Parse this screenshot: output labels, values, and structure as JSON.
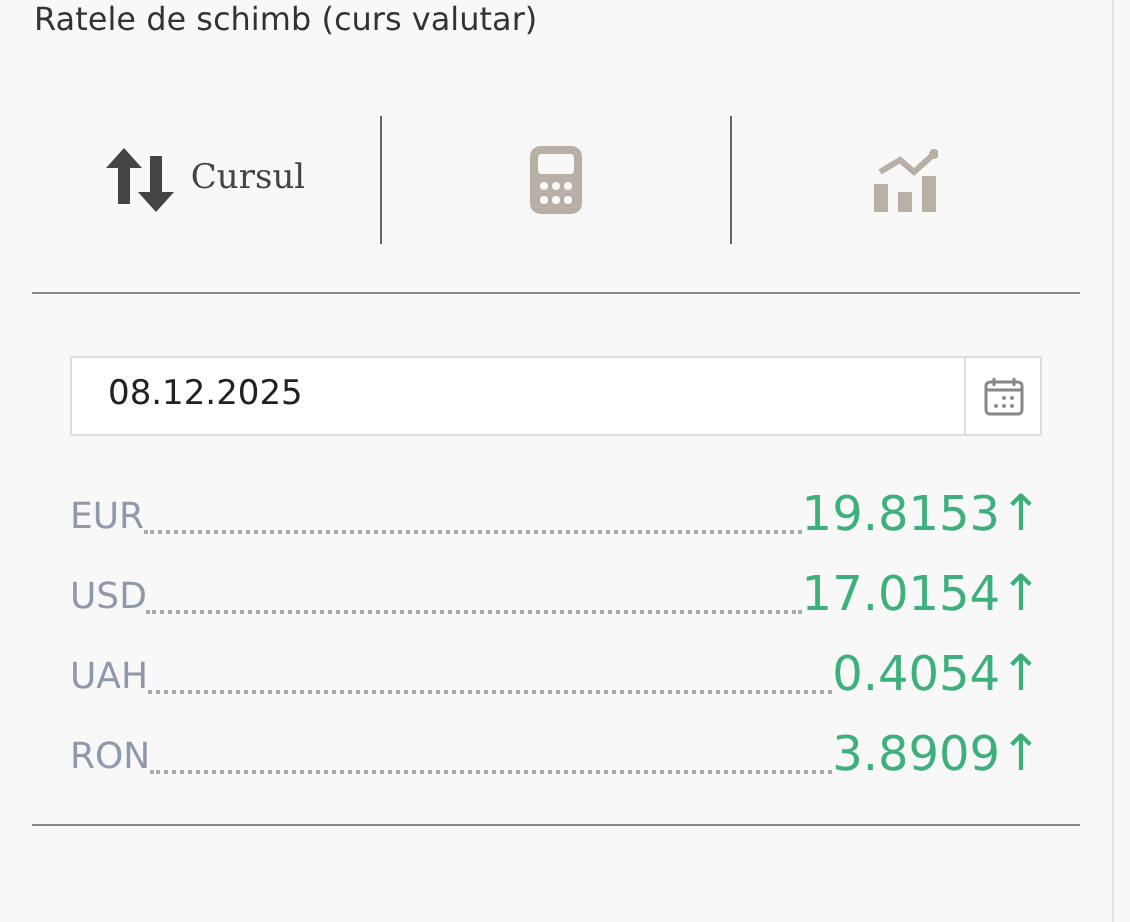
{
  "title": "Ratele de schimb (curs valutar)",
  "tabs": [
    {
      "kind": "rates",
      "label": "Cursul",
      "selected": true
    },
    {
      "kind": "calculator",
      "selected": false
    },
    {
      "kind": "chart",
      "selected": false
    }
  ],
  "date_field": {
    "value": "08.12.2025"
  },
  "rates": [
    {
      "code": "EUR",
      "value": "19.8153",
      "trend": "↑"
    },
    {
      "code": "USD",
      "value": "17.0154",
      "trend": "↑"
    },
    {
      "code": "UAH",
      "value": "0.4054",
      "trend": "↑"
    },
    {
      "code": "RON",
      "value": "3.8909",
      "trend": "↑"
    }
  ]
}
